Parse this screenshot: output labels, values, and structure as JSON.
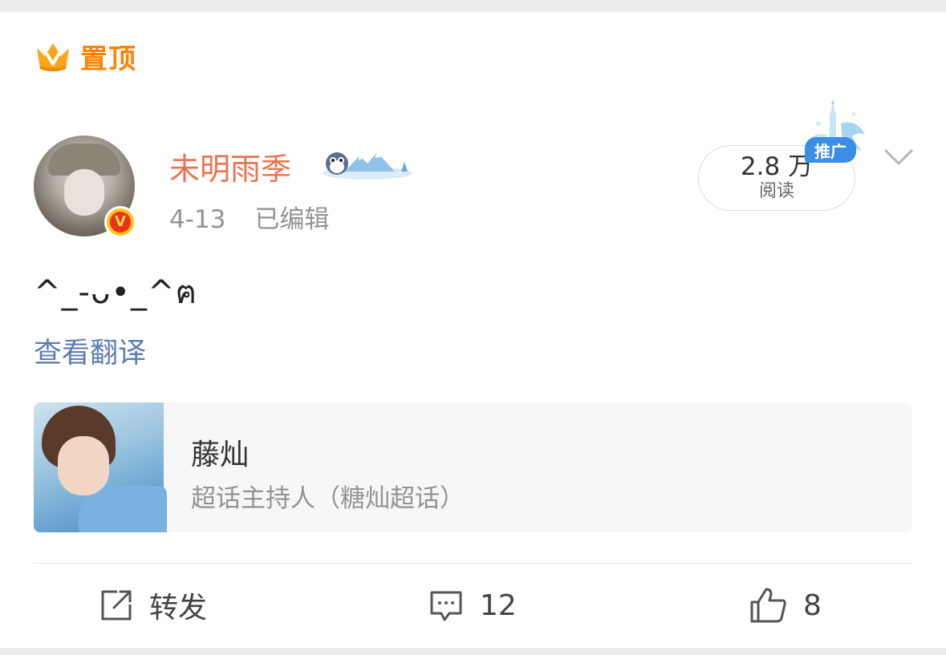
{
  "post": {
    "pin_label": "置顶",
    "user": {
      "name": "未明雨季",
      "verified_badge": "V",
      "avatar": "user-avatar",
      "medal": "winter-snow-medal-icon"
    },
    "date": "4-13",
    "edited_label": "已编辑",
    "reads": {
      "count": "2.8 万",
      "label": "阅读",
      "promo_tag": "推广"
    },
    "content": "^_-ᴗ•_^ฅ",
    "translate_link": "查看翻译",
    "topic_card": {
      "title": "藤灿",
      "subtitle": "超话主持人（糖灿超话）"
    },
    "actions": {
      "repost_label": "转发",
      "comment_count": "12",
      "like_count": "8"
    }
  },
  "colors": {
    "username": "#eb7350",
    "pin": "#ff8200",
    "link": "#5b7bb3",
    "promo": "#3a8ee6",
    "verified": "#e8331a"
  }
}
